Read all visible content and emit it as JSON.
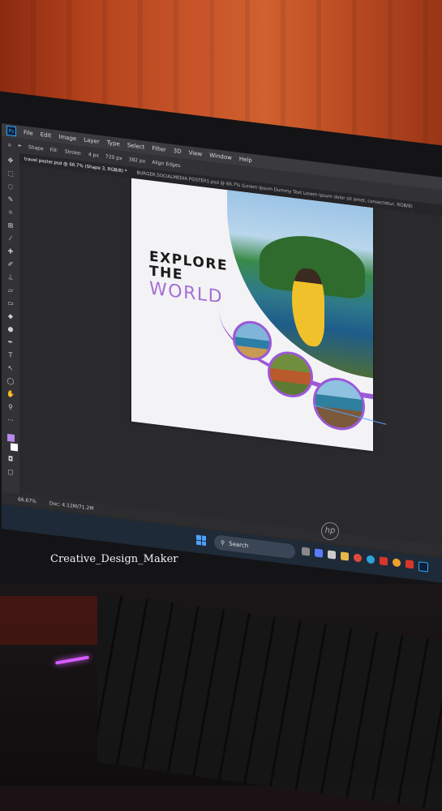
{
  "photoshop": {
    "menu": [
      "File",
      "Edit",
      "Image",
      "Layer",
      "Type",
      "Select",
      "Filter",
      "3D",
      "View",
      "Window",
      "Help"
    ],
    "options": {
      "mode": "Shape",
      "fill_label": "Fill:",
      "stroke_label": "Stroke:",
      "stroke_size": "4 px",
      "width": "720 px",
      "height": "382 px",
      "align_edges": "Align Edges"
    },
    "tabs": [
      {
        "label": "travel poster.psd @ 66.7% (Shape 3, RGB/8) *"
      },
      {
        "label": "BURGER.SOCIALMEDIA POSTER1.psd @ 66.7% (Lorem Ipsum Dummy Text Lorem ipsum dolor sit amet, consectetur, RGB/8)"
      }
    ],
    "status": {
      "zoom": "66.67%",
      "doc": "Doc: 4.12M/71.2M"
    }
  },
  "poster": {
    "line1": "EXPLORE",
    "line2": "THE",
    "line3": "WORLD"
  },
  "taskbar": {
    "search_label": "Search"
  },
  "overlay": {
    "credit": "Creative_Design_Maker",
    "laptop_brand": "hp"
  },
  "colors": {
    "accent_purple": "#9b59d6",
    "wall": "#c8552a",
    "keyboard_light": "#d75cff"
  }
}
